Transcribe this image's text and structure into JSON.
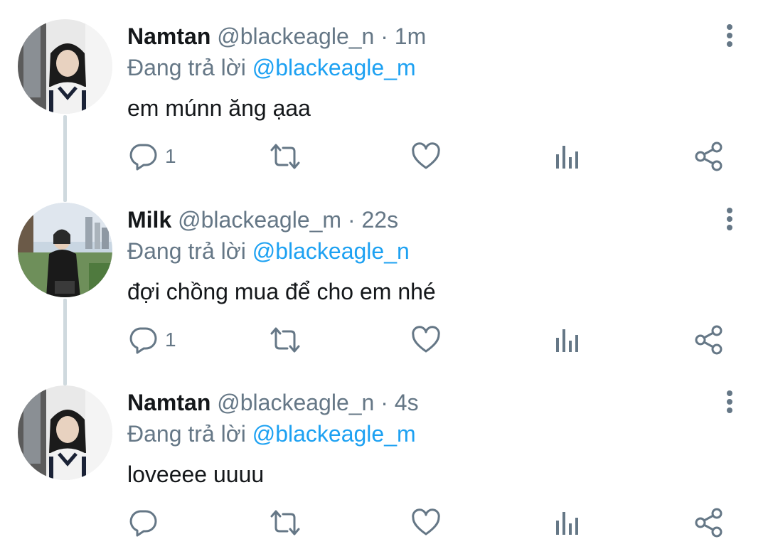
{
  "tweets": [
    {
      "name": "Namtan",
      "handle": "@blackeagle_n",
      "separator": " · ",
      "time": "1m",
      "replying_prefix": "Đang trả lời ",
      "replying_to": "@blackeagle_m",
      "text": "em múnn ăng ạaa",
      "reply_count": "1",
      "avatar": "namtan-avatar"
    },
    {
      "name": "Milk",
      "handle": "@blackeagle_m",
      "separator": " · ",
      "time": "22s",
      "replying_prefix": "Đang trả lời ",
      "replying_to": "@blackeagle_n",
      "text": "đợi chồng mua để cho em nhé",
      "reply_count": "1",
      "avatar": "milk-avatar"
    },
    {
      "name": "Namtan",
      "handle": "@blackeagle_n",
      "separator": " · ",
      "time": "4s",
      "replying_prefix": "Đang trả lời ",
      "replying_to": "@blackeagle_m",
      "text": "loveeee uuuu",
      "reply_count": "",
      "avatar": "namtan-avatar"
    }
  ],
  "icons": {
    "reply": "reply-icon",
    "retweet": "retweet-icon",
    "like": "heart-icon",
    "stats": "analytics-icon",
    "share": "share-icon",
    "more": "more-vertical-icon"
  },
  "colors": {
    "name": "#14171a",
    "meta": "#657786",
    "mention": "#1da1f2",
    "thread_line": "#cfd9de"
  }
}
